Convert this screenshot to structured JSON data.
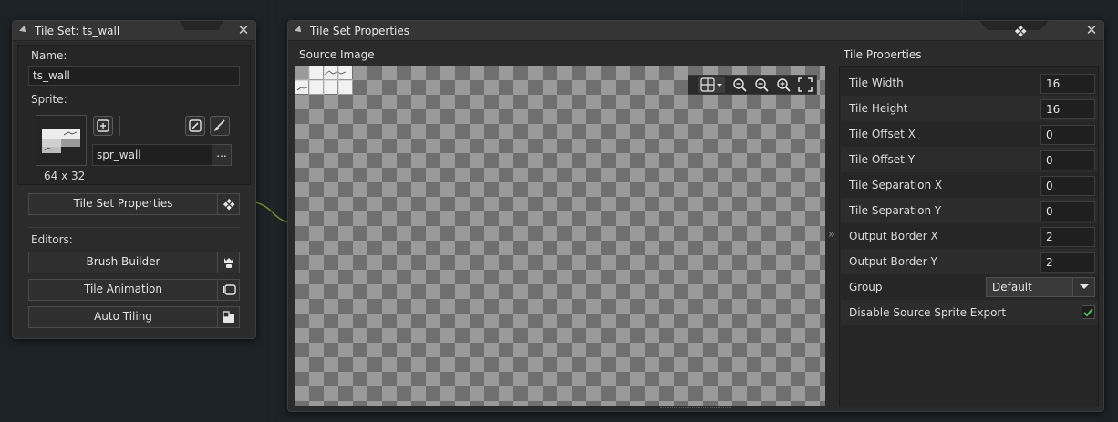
{
  "tileset_window": {
    "title": "Tile Set: ts_wall",
    "name_label": "Name:",
    "name_value": "ts_wall",
    "sprite_label": "Sprite:",
    "sprite_size": "64 x 32",
    "sprite_value": "spr_wall",
    "browse_label": "...",
    "properties_button": "Tile Set Properties",
    "editors_label": "Editors:",
    "editors": [
      {
        "label": "Brush Builder",
        "icon": "brush-builder-icon"
      },
      {
        "label": "Tile Animation",
        "icon": "tile-animation-icon"
      },
      {
        "label": "Auto Tiling",
        "icon": "auto-tiling-icon"
      }
    ]
  },
  "properties_window": {
    "title": "Tile Set Properties",
    "source_label": "Source Image",
    "expand_glyph": "»",
    "tile_props_label": "Tile Properties",
    "rows": [
      {
        "label": "Tile Width",
        "value": "16"
      },
      {
        "label": "Tile Height",
        "value": "16"
      },
      {
        "label": "Tile Offset X",
        "value": "0"
      },
      {
        "label": "Tile Offset Y",
        "value": "0"
      },
      {
        "label": "Tile Separation X",
        "value": "0"
      },
      {
        "label": "Tile Separation Y",
        "value": "0"
      },
      {
        "label": "Output Border X",
        "value": "2"
      },
      {
        "label": "Output Border Y",
        "value": "2"
      }
    ],
    "group_label": "Group",
    "group_value": "Default",
    "disable_export_label": "Disable Source Sprite Export",
    "disable_export_checked": true
  },
  "colors": {
    "accent_green": "#5fae52",
    "check_green": "#54c06a",
    "connector": "#6f8d2e"
  }
}
